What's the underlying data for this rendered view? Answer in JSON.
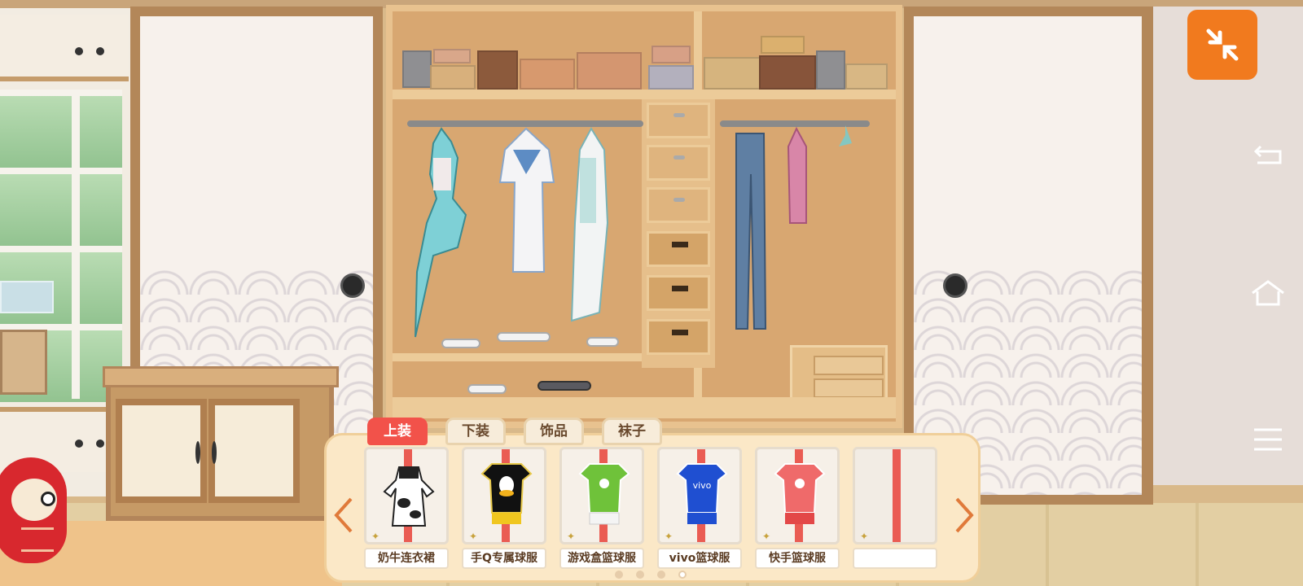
{
  "tabs": [
    {
      "label": "上装",
      "active": true
    },
    {
      "label": "下装",
      "active": false
    },
    {
      "label": "饰品",
      "active": false
    },
    {
      "label": "袜子",
      "active": false
    }
  ],
  "items": [
    {
      "label": "奶牛连衣裙",
      "icon": "cow-dress-icon"
    },
    {
      "label": "手Q专属球服",
      "icon": "qq-jersey-icon"
    },
    {
      "label": "游戏盒篮球服",
      "icon": "green-jersey-icon"
    },
    {
      "label": "vivo篮球服",
      "icon": "vivo-jersey-icon",
      "print": "vivo"
    },
    {
      "label": "快手篮球服",
      "icon": "kuaishou-jersey-icon"
    },
    {
      "label": "",
      "icon": "empty-slot-icon"
    }
  ],
  "pagination": {
    "total": 4,
    "current": 4
  },
  "colors": {
    "accent": "#f17a1e",
    "active_tab": "#f2524a"
  }
}
